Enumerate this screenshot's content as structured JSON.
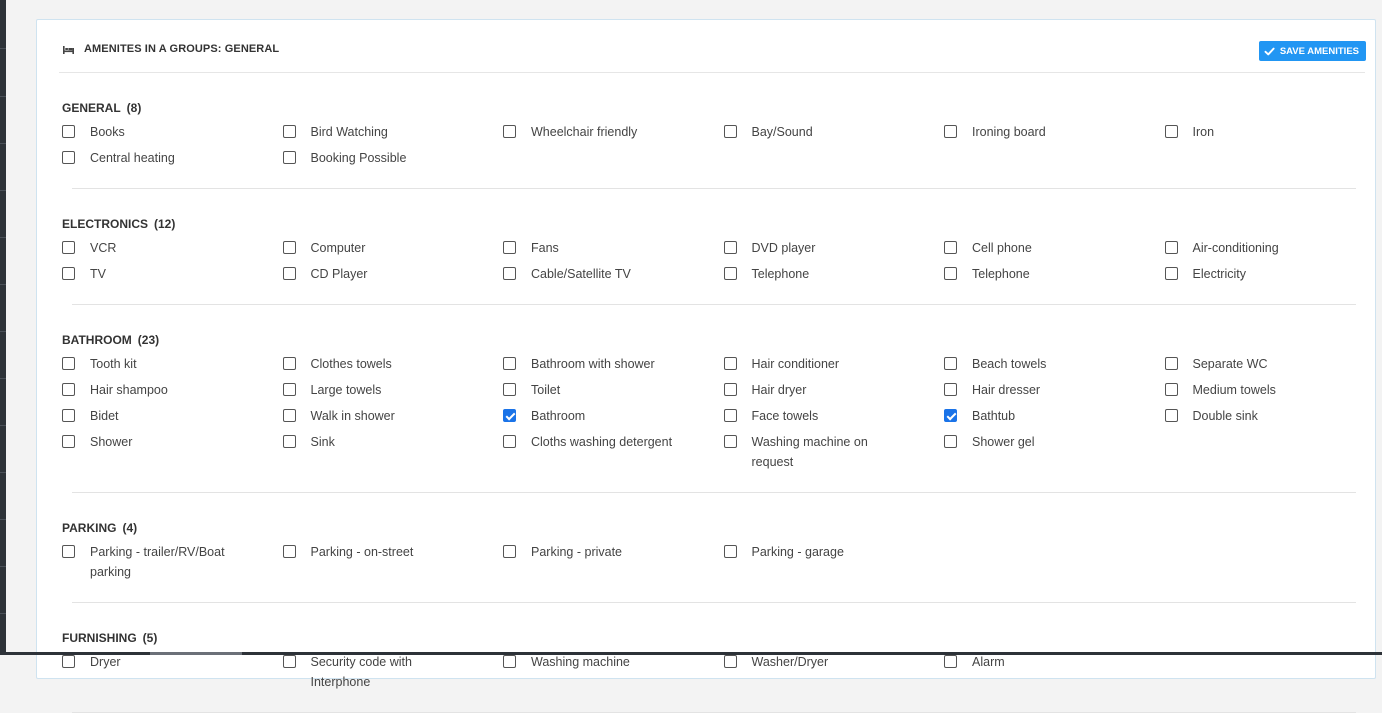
{
  "panel": {
    "title": "AMENITES IN A GROUPS: GENERAL",
    "save_label": "SAVE AMENITIES",
    "accent_color": "#2196f3"
  },
  "groups": [
    {
      "name": "GENERAL",
      "count": "(8)",
      "items": [
        {
          "label": "Books",
          "checked": false
        },
        {
          "label": "Bird Watching",
          "checked": false
        },
        {
          "label": "Wheelchair friendly",
          "checked": false
        },
        {
          "label": "Bay/Sound",
          "checked": false
        },
        {
          "label": "Ironing board",
          "checked": false
        },
        {
          "label": "Iron",
          "checked": false
        },
        {
          "label": "Central heating",
          "checked": false
        },
        {
          "label": "Booking Possible",
          "checked": false
        }
      ]
    },
    {
      "name": "ELECTRONICS",
      "count": "(12)",
      "items": [
        {
          "label": "VCR",
          "checked": false
        },
        {
          "label": "Computer",
          "checked": false
        },
        {
          "label": "Fans",
          "checked": false
        },
        {
          "label": "DVD player",
          "checked": false
        },
        {
          "label": "Cell phone",
          "checked": false
        },
        {
          "label": "Air-conditioning",
          "checked": false
        },
        {
          "label": "TV",
          "checked": false
        },
        {
          "label": "CD Player",
          "checked": false
        },
        {
          "label": "Cable/Satellite TV",
          "checked": false
        },
        {
          "label": "Telephone",
          "checked": false
        },
        {
          "label": "Telephone",
          "checked": false
        },
        {
          "label": "Electricity",
          "checked": false
        }
      ]
    },
    {
      "name": "BATHROOM",
      "count": "(23)",
      "items": [
        {
          "label": "Tooth kit",
          "checked": false
        },
        {
          "label": "Clothes towels",
          "checked": false
        },
        {
          "label": "Bathroom with shower",
          "checked": false
        },
        {
          "label": "Hair conditioner",
          "checked": false
        },
        {
          "label": "Beach towels",
          "checked": false
        },
        {
          "label": "Separate WC",
          "checked": false
        },
        {
          "label": "Hair shampoo",
          "checked": false
        },
        {
          "label": "Large towels",
          "checked": false
        },
        {
          "label": "Toilet",
          "checked": false
        },
        {
          "label": "Hair dryer",
          "checked": false
        },
        {
          "label": "Hair dresser",
          "checked": false
        },
        {
          "label": "Medium towels",
          "checked": false
        },
        {
          "label": "Bidet",
          "checked": false
        },
        {
          "label": "Walk in shower",
          "checked": false
        },
        {
          "label": "Bathroom",
          "checked": true
        },
        {
          "label": "Face towels",
          "checked": false
        },
        {
          "label": "Bathtub",
          "checked": true
        },
        {
          "label": "Double sink",
          "checked": false
        },
        {
          "label": "Shower",
          "checked": false
        },
        {
          "label": "Sink",
          "checked": false
        },
        {
          "label": "Cloths washing detergent",
          "checked": false
        },
        {
          "label": "Washing machine on request",
          "checked": false
        },
        {
          "label": "Shower gel",
          "checked": false
        }
      ]
    },
    {
      "name": "PARKING",
      "count": "(4)",
      "items": [
        {
          "label": "Parking - trailer/RV/Boat parking",
          "checked": false
        },
        {
          "label": "Parking - on-street",
          "checked": false
        },
        {
          "label": "Parking - private",
          "checked": false
        },
        {
          "label": "Parking - garage",
          "checked": false
        }
      ]
    },
    {
      "name": "FURNISHING",
      "count": "(5)",
      "items": [
        {
          "label": "Dryer",
          "checked": false
        },
        {
          "label": "Security code with Interphone",
          "checked": false
        },
        {
          "label": "Washing machine",
          "checked": false
        },
        {
          "label": "Washer/Dryer",
          "checked": false
        },
        {
          "label": "Alarm",
          "checked": false
        }
      ]
    }
  ]
}
